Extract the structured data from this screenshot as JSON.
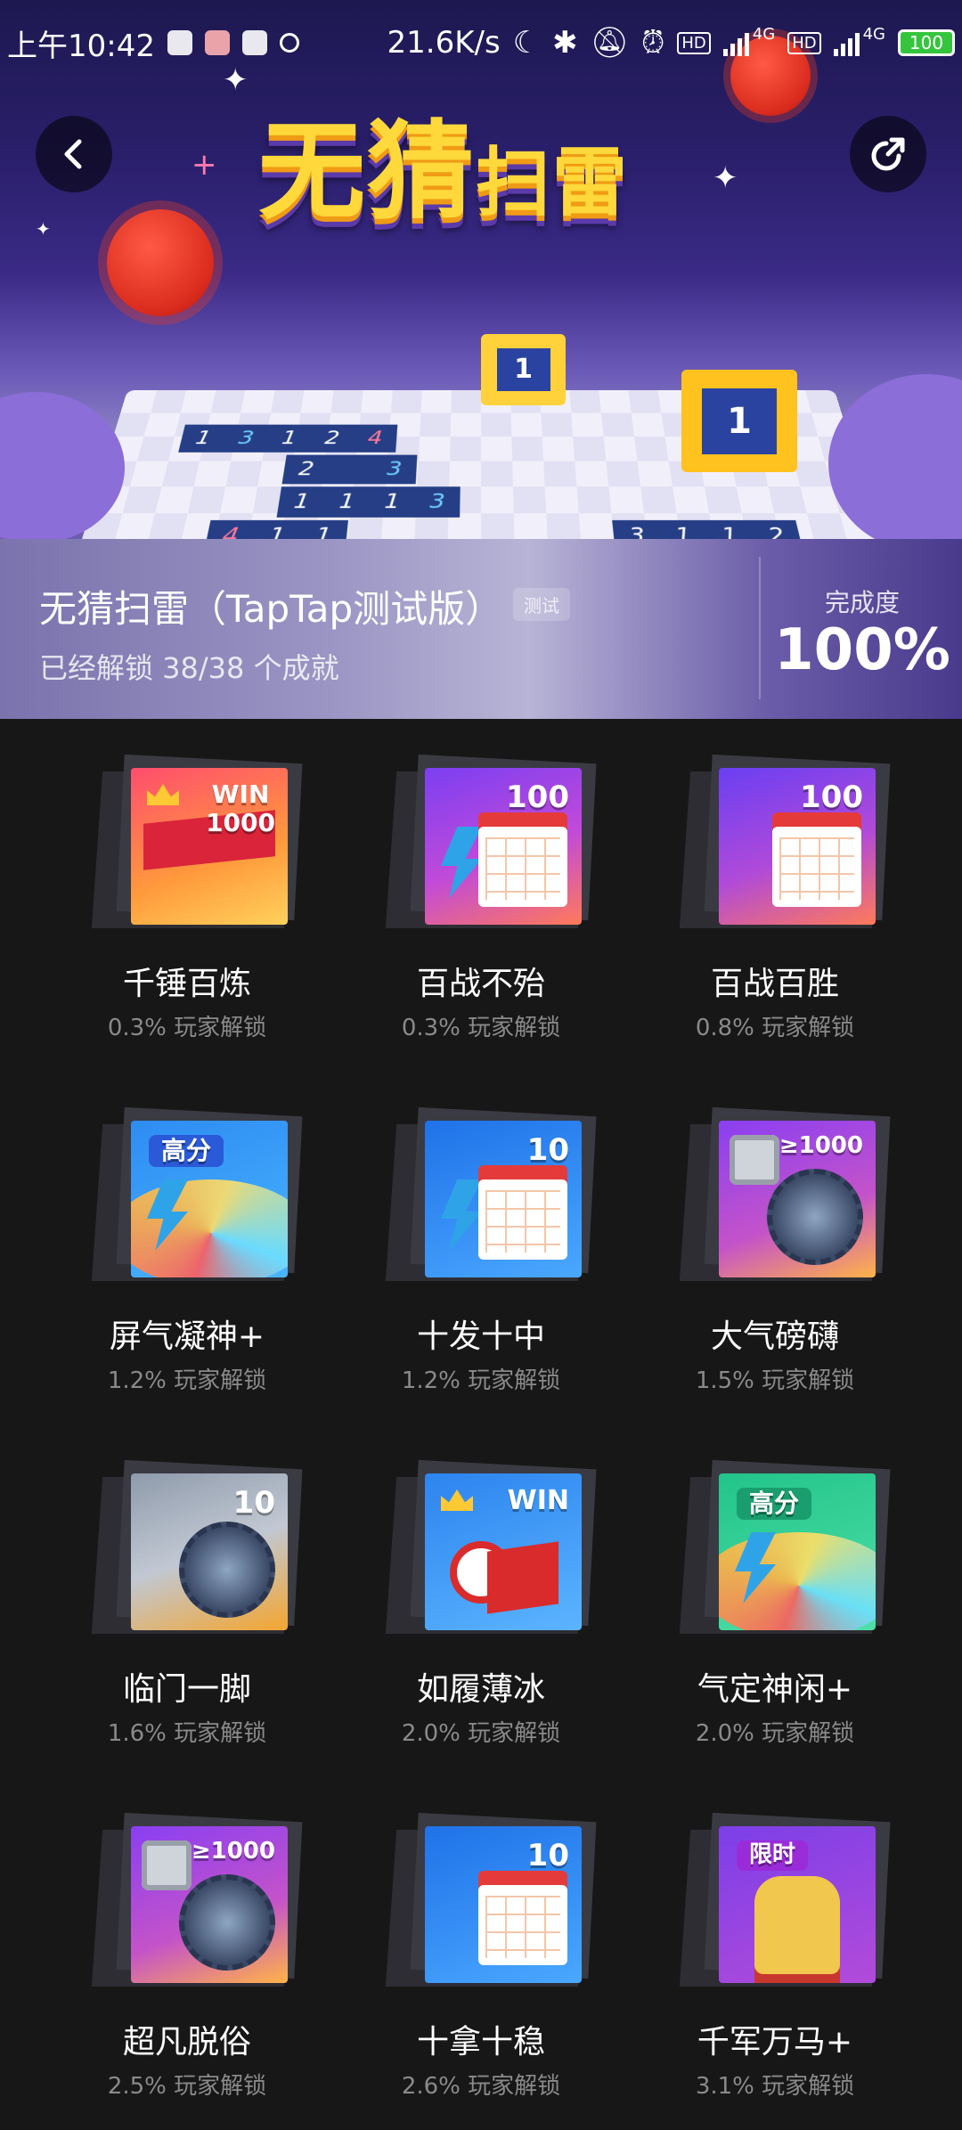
{
  "status_bar": {
    "time": "上午10:42",
    "speed": "21.6K/s",
    "net1": "4G",
    "net2": "4G",
    "hd1": "HD",
    "hd2": "HD",
    "battery": "100"
  },
  "banner": {
    "title_main": "无猜",
    "title_sub": "扫雷"
  },
  "game": {
    "name": "无猜扫雷（TapTap测试版）",
    "tag": "测试",
    "unlocked": "已经解锁 38/38 个成就",
    "completion_label": "完成度",
    "completion_value": "100%"
  },
  "achievements": [
    {
      "title": "千锤百炼",
      "sub": "0.3% 玩家解锁",
      "badge": "WIN\n1000",
      "theme": "win1000"
    },
    {
      "title": "百战不殆",
      "sub": "0.3% 玩家解锁",
      "badge": "100",
      "theme": "cal-purple"
    },
    {
      "title": "百战百胜",
      "sub": "0.8% 玩家解锁",
      "badge": "100",
      "theme": "cal-purple-check"
    },
    {
      "title": "屏气凝神+",
      "sub": "1.2% 玩家解锁",
      "badge": "高分",
      "theme": "wave-blue"
    },
    {
      "title": "十发十中",
      "sub": "1.2% 玩家解锁",
      "badge": "10",
      "theme": "cal-blue"
    },
    {
      "title": "大气磅礴",
      "sub": "1.5% 玩家解锁",
      "badge": "≥1000",
      "theme": "mine-purple"
    },
    {
      "title": "临门一脚",
      "sub": "1.6% 玩家解锁",
      "badge": "10",
      "theme": "mine-gray"
    },
    {
      "title": "如履薄冰",
      "sub": "2.0% 玩家解锁",
      "badge": "WIN",
      "theme": "flag-blue"
    },
    {
      "title": "气定神闲+",
      "sub": "2.0% 玩家解锁",
      "badge": "高分",
      "theme": "wave-green"
    },
    {
      "title": "超凡脱俗",
      "sub": "2.5% 玩家解锁",
      "badge": "≥1000",
      "theme": "mine-purple"
    },
    {
      "title": "十拿十稳",
      "sub": "2.6% 玩家解锁",
      "badge": "10",
      "theme": "cal-blue-check"
    },
    {
      "title": "千军万马+",
      "sub": "3.1% 玩家解锁",
      "badge": "限时",
      "theme": "knight"
    }
  ],
  "colors": {
    "background": "#171717",
    "subtext": "#8a8a8a",
    "accent_gold": "#ffd93b"
  },
  "icons": {
    "back": "chevron-left-icon",
    "share": "share-icon"
  }
}
